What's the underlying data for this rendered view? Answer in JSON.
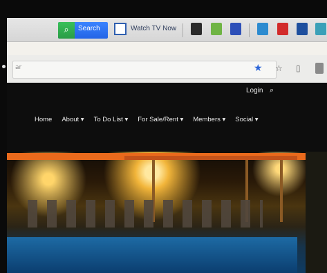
{
  "toolbar": {
    "search_label": "Search",
    "tv_label": "Watch TV Now",
    "colors": {
      "search_bg": "#2364e6",
      "search_icon_bg": "#2a9c46"
    }
  },
  "addressbar": {
    "url": "ar"
  },
  "site": {
    "login_label": "Login",
    "nav": [
      "Home",
      "About ▾",
      "To Do List ▾",
      "For Sale/Rent ▾",
      "Members ▾",
      "Social ▾"
    ]
  }
}
